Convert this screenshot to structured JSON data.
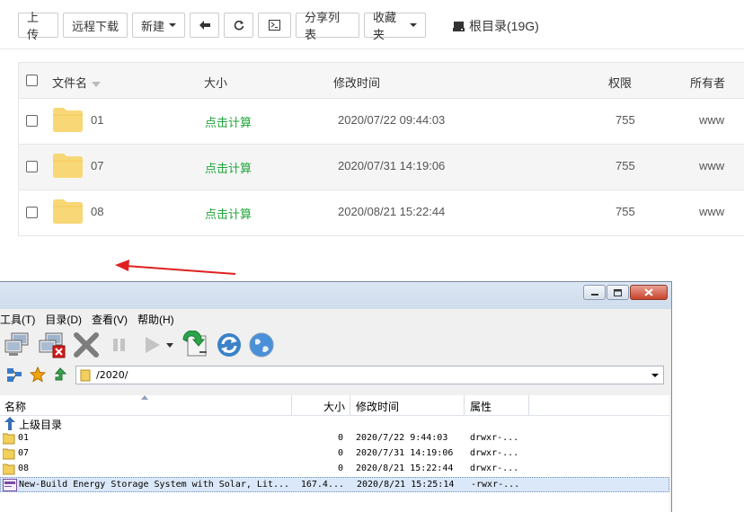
{
  "web": {
    "toolbar": {
      "upload": "上传",
      "remote_download": "远程下载",
      "new": "新建",
      "share_list": "分享列表",
      "favorites": "收藏夹"
    },
    "root": {
      "label": "根目录(19G)"
    },
    "table": {
      "headers": {
        "name": "文件名",
        "size": "大小",
        "mtime": "修改时间",
        "perm": "权限",
        "owner": "所有者"
      },
      "rows": [
        {
          "name": "01",
          "size": "点击计算",
          "mtime": "2020/07/22 09:44:03",
          "perm": "755",
          "owner": "www"
        },
        {
          "name": "07",
          "size": "点击计算",
          "mtime": "2020/07/31 14:19:06",
          "perm": "755",
          "owner": "www"
        },
        {
          "name": "08",
          "size": "点击计算",
          "mtime": "2020/08/21 15:22:44",
          "perm": "755",
          "owner": "www"
        }
      ]
    }
  },
  "ftp": {
    "menu": [
      "工具(T)",
      "目录(D)",
      "查看(V)",
      "帮助(H)"
    ],
    "path": "/2020/",
    "headers": {
      "name": "名称",
      "size": "大小",
      "mtime": "修改时间",
      "attr": "属性"
    },
    "up_label": "上级目录",
    "rows": [
      {
        "name": "01",
        "size": "0",
        "mtime": "2020/7/22 9:44:03",
        "attr": "drwxr-..."
      },
      {
        "name": "07",
        "size": "0",
        "mtime": "2020/7/31 14:19:06",
        "attr": "drwxr-..."
      },
      {
        "name": "08",
        "size": "0",
        "mtime": "2020/8/21 15:22:44",
        "attr": "drwxr-..."
      },
      {
        "name": "New-Build Energy Storage System with Solar, Lit...",
        "size": "167.4...",
        "mtime": "2020/8/21 15:25:14",
        "attr": "-rwxr-..."
      }
    ]
  },
  "colors": {
    "accent_green": "#20a53a",
    "folder_yellow": "#f8d776",
    "annotation_red": "#e02020"
  },
  "icons": [
    "sort-down-icon",
    "arrow-left-icon",
    "refresh-icon",
    "terminal-icon",
    "disk-icon",
    "folder-icon",
    "minimize-icon",
    "maximize-icon",
    "close-icon",
    "connect-icon",
    "disconnect-icon",
    "stop-icon",
    "pause-icon",
    "play-icon",
    "download-icon",
    "sync-icon",
    "globe-icon",
    "sitemap-icon",
    "star-icon",
    "go-up-icon"
  ]
}
